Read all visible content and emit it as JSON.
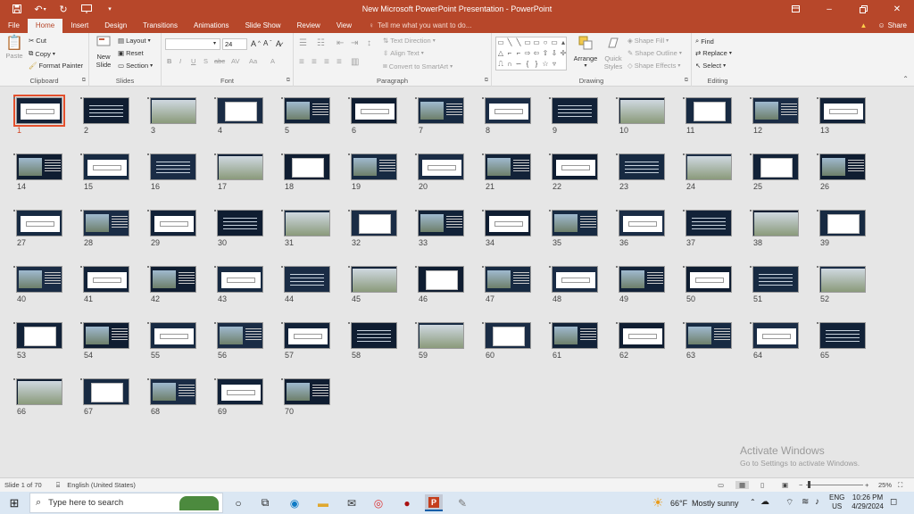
{
  "window": {
    "title": "New Microsoft PowerPoint Presentation - PowerPoint"
  },
  "tabs": {
    "file": "File",
    "home": "Home",
    "insert": "Insert",
    "design": "Design",
    "transitions": "Transitions",
    "animations": "Animations",
    "slideshow": "Slide Show",
    "review": "Review",
    "view": "View"
  },
  "tellme": "Tell me what you want to do...",
  "share": "Share",
  "ribbon": {
    "clipboard": {
      "label": "Clipboard",
      "paste": "Paste",
      "cut": "Cut",
      "copy": "Copy",
      "format_painter": "Format Painter"
    },
    "slides": {
      "label": "Slides",
      "new_slide_1": "New",
      "new_slide_2": "Slide",
      "layout": "Layout",
      "reset": "Reset",
      "section": "Section"
    },
    "font": {
      "label": "Font",
      "size": "24"
    },
    "paragraph": {
      "label": "Paragraph",
      "text_direction": "Text Direction",
      "align_text": "Align Text",
      "convert_smartart": "Convert to SmartArt"
    },
    "drawing": {
      "label": "Drawing",
      "arrange": "Arrange",
      "quick_styles_1": "Quick",
      "quick_styles_2": "Styles",
      "shape_fill": "Shape Fill",
      "shape_outline": "Shape Outline",
      "shape_effects": "Shape Effects"
    },
    "editing": {
      "label": "Editing",
      "find": "Find",
      "replace": "Replace",
      "select": "Select"
    }
  },
  "slides": [
    "1",
    "2",
    "3",
    "4",
    "5",
    "6",
    "7",
    "8",
    "9",
    "10",
    "11",
    "12",
    "13",
    "14",
    "15",
    "16",
    "17",
    "18",
    "19",
    "20",
    "21",
    "22",
    "23",
    "24",
    "25",
    "26",
    "27",
    "28",
    "29",
    "30",
    "31",
    "32",
    "33",
    "34",
    "35",
    "36",
    "37",
    "38",
    "39",
    "40",
    "41",
    "42",
    "43",
    "44",
    "45",
    "46",
    "47",
    "48",
    "49",
    "50",
    "51",
    "52",
    "53",
    "54",
    "55",
    "56",
    "57",
    "58",
    "59",
    "60",
    "61",
    "62",
    "63",
    "64",
    "65",
    "66",
    "67",
    "68",
    "69",
    "70"
  ],
  "selected_slide": "1",
  "watermark": {
    "line1": "Activate Windows",
    "line2": "Go to Settings to activate Windows."
  },
  "status": {
    "slide_of": "Slide 1 of 70",
    "language": "English (United States)",
    "zoom": "25%"
  },
  "taskbar": {
    "search_placeholder": "Type here to search",
    "weather_temp": "66°F",
    "weather_text": "Mostly sunny",
    "lang1": "ENG",
    "lang2": "US",
    "time": "10:26 PM",
    "date": "4/29/2024"
  },
  "colors": {
    "accent": "#b7472a",
    "selection": "#e3502d",
    "slide_bg": "#16263b"
  }
}
